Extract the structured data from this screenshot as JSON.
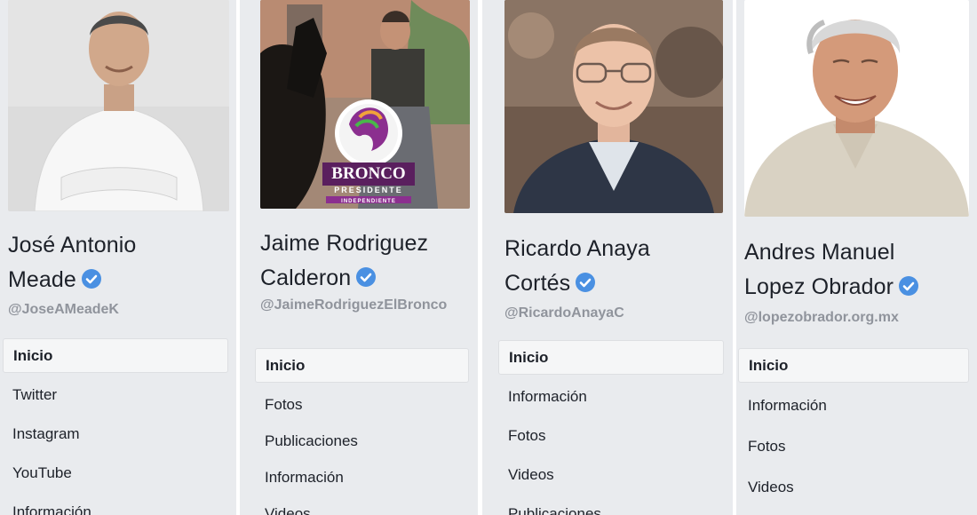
{
  "profiles": [
    {
      "name_line1": "José Antonio",
      "name_line2": "Meade",
      "verified_icon": "verified-badge-icon",
      "handle": "@JoseAMeadeK",
      "nav": [
        "Inicio",
        "Twitter",
        "Instagram",
        "YouTube",
        "Información"
      ]
    },
    {
      "name_line1": "Jaime Rodriguez",
      "name_line2": "Calderon",
      "verified_icon": "verified-badge-icon",
      "handle": "@JaimeRodriguezElBronco",
      "logo_text_1": "BRONCO",
      "logo_text_2": "PRESIDENTE",
      "logo_text_3": "INDEPENDIENTE",
      "nav": [
        "Inicio",
        "Fotos",
        "Publicaciones",
        "Información",
        "Videos"
      ]
    },
    {
      "name_line1": "Ricardo Anaya",
      "name_line2": "Cortés",
      "verified_icon": "verified-badge-icon",
      "handle": "@RicardoAnayaC",
      "nav": [
        "Inicio",
        "Información",
        "Fotos",
        "Videos",
        "Publicaciones"
      ]
    },
    {
      "name_line1": "Andres Manuel",
      "name_line2": "Lopez Obrador",
      "verified_icon": "verified-badge-icon",
      "handle": "@lopezobrador.org.mx",
      "nav": [
        "Inicio",
        "Información",
        "Fotos",
        "Videos"
      ]
    }
  ],
  "colors": {
    "panel_bg": "#e9ebee",
    "verified": "#4a90e2",
    "handle": "#90949c",
    "text": "#1d2129"
  }
}
